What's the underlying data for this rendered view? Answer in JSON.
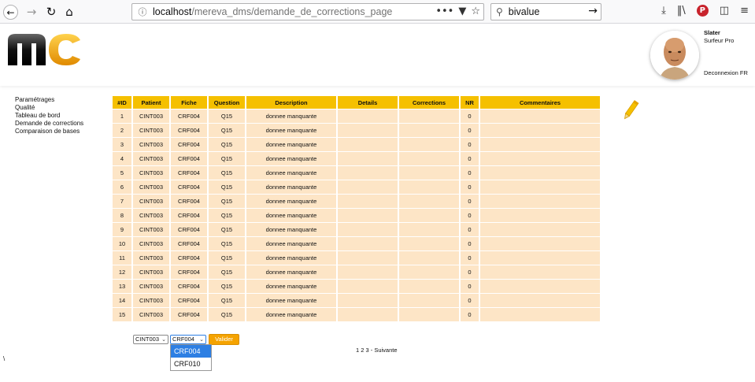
{
  "browser": {
    "url_host": "localhost",
    "url_path": "/mereva_dms/demande_de_corrections_page",
    "search_value": "bivalue"
  },
  "header": {
    "logo_text": "mc",
    "user_name": "Slater",
    "user_role": "Surfeur Pro",
    "logout_label": "Deconnexion FR"
  },
  "sidebar": {
    "items": [
      {
        "label": "Paramétrages"
      },
      {
        "label": "Qualité"
      },
      {
        "label": "Tableau de bord"
      },
      {
        "label": "Demande de corrections"
      },
      {
        "label": "Comparaison de bases"
      }
    ]
  },
  "table": {
    "columns": [
      "#ID",
      "Patient",
      "Fiche",
      "Question",
      "Description",
      "Details",
      "Corrections",
      "NR",
      "Commentaires"
    ],
    "rows": [
      {
        "id": "1",
        "patient": "CINT003",
        "fiche": "CRF004",
        "question": "Q15",
        "description": "donnee manquante",
        "details": "",
        "corrections": "",
        "nr": "0",
        "commentaires": ""
      },
      {
        "id": "2",
        "patient": "CINT003",
        "fiche": "CRF004",
        "question": "Q15",
        "description": "donnee manquante",
        "details": "",
        "corrections": "",
        "nr": "0",
        "commentaires": ""
      },
      {
        "id": "3",
        "patient": "CINT003",
        "fiche": "CRF004",
        "question": "Q15",
        "description": "donnee manquante",
        "details": "",
        "corrections": "",
        "nr": "0",
        "commentaires": ""
      },
      {
        "id": "4",
        "patient": "CINT003",
        "fiche": "CRF004",
        "question": "Q15",
        "description": "donnee manquante",
        "details": "",
        "corrections": "",
        "nr": "0",
        "commentaires": ""
      },
      {
        "id": "5",
        "patient": "CINT003",
        "fiche": "CRF004",
        "question": "Q15",
        "description": "donnee manquante",
        "details": "",
        "corrections": "",
        "nr": "0",
        "commentaires": ""
      },
      {
        "id": "6",
        "patient": "CINT003",
        "fiche": "CRF004",
        "question": "Q15",
        "description": "donnee manquante",
        "details": "",
        "corrections": "",
        "nr": "0",
        "commentaires": ""
      },
      {
        "id": "7",
        "patient": "CINT003",
        "fiche": "CRF004",
        "question": "Q15",
        "description": "donnee manquante",
        "details": "",
        "corrections": "",
        "nr": "0",
        "commentaires": ""
      },
      {
        "id": "8",
        "patient": "CINT003",
        "fiche": "CRF004",
        "question": "Q15",
        "description": "donnee manquante",
        "details": "",
        "corrections": "",
        "nr": "0",
        "commentaires": ""
      },
      {
        "id": "9",
        "patient": "CINT003",
        "fiche": "CRF004",
        "question": "Q15",
        "description": "donnee manquante",
        "details": "",
        "corrections": "",
        "nr": "0",
        "commentaires": ""
      },
      {
        "id": "10",
        "patient": "CINT003",
        "fiche": "CRF004",
        "question": "Q15",
        "description": "donnee manquante",
        "details": "",
        "corrections": "",
        "nr": "0",
        "commentaires": ""
      },
      {
        "id": "11",
        "patient": "CINT003",
        "fiche": "CRF004",
        "question": "Q15",
        "description": "donnee manquante",
        "details": "",
        "corrections": "",
        "nr": "0",
        "commentaires": ""
      },
      {
        "id": "12",
        "patient": "CINT003",
        "fiche": "CRF004",
        "question": "Q15",
        "description": "donnee manquante",
        "details": "",
        "corrections": "",
        "nr": "0",
        "commentaires": ""
      },
      {
        "id": "13",
        "patient": "CINT003",
        "fiche": "CRF004",
        "question": "Q15",
        "description": "donnee manquante",
        "details": "",
        "corrections": "",
        "nr": "0",
        "commentaires": ""
      },
      {
        "id": "14",
        "patient": "CINT003",
        "fiche": "CRF004",
        "question": "Q15",
        "description": "donnee manquante",
        "details": "",
        "corrections": "",
        "nr": "0",
        "commentaires": ""
      },
      {
        "id": "15",
        "patient": "CINT003",
        "fiche": "CRF004",
        "question": "Q15",
        "description": "donnee manquante",
        "details": "",
        "corrections": "",
        "nr": "0",
        "commentaires": ""
      }
    ]
  },
  "filters": {
    "patient_value": "CINT003",
    "fiche_value": "CRF004",
    "validate_label": "Valider",
    "fiche_options": [
      "CRF004",
      "CRF010"
    ]
  },
  "pager": {
    "text": "1 2 3 - Suivante"
  },
  "stray_text": "\\",
  "colors": {
    "header_bg": "#f5c000",
    "row_bg": "#fde5c6",
    "button_bg": "#f5a300",
    "dropdown_selected": "#2d7fe3"
  },
  "icons": [
    "back-arrow-icon",
    "forward-arrow-icon",
    "reload-icon",
    "home-icon",
    "info-icon",
    "more-dots-icon",
    "pocket-icon",
    "bookmark-star-icon",
    "search-icon",
    "go-arrow-icon",
    "download-icon",
    "library-icon",
    "pinterest-icon",
    "sidebar-icon",
    "menu-icon",
    "pencil-edit-icon"
  ]
}
